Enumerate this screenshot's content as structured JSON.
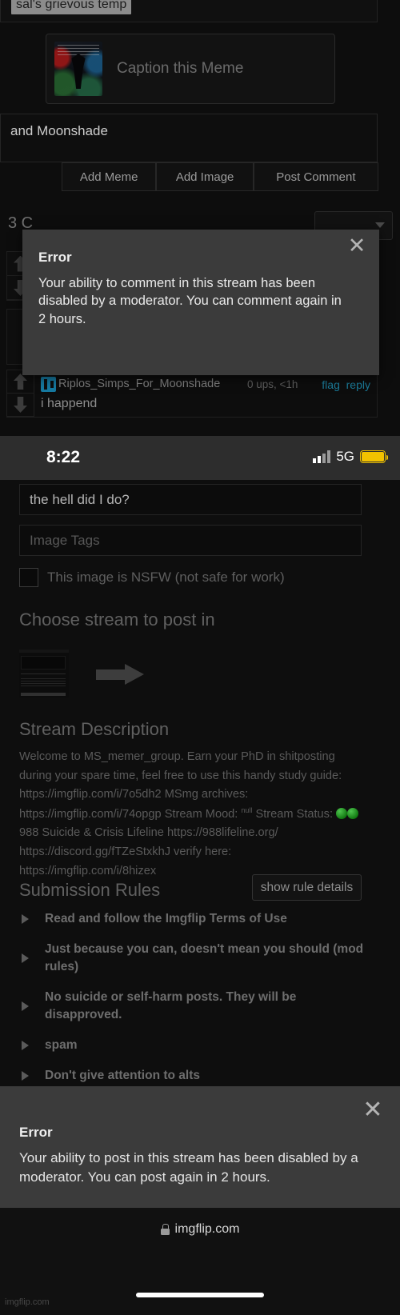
{
  "top_screen": {
    "clipped_text": "sal's grievous temp",
    "meme_attach_label": "Caption this Meme",
    "comment_input_value": "and Moonshade",
    "buttons": {
      "add_meme": "Add Meme",
      "add_image": "Add Image",
      "post_comment": "Post Comment"
    },
    "comments_header": "3 C",
    "comments": [
      {
        "username": "",
        "ups": "",
        "body": "",
        "reply": "reply"
      },
      {
        "username": "",
        "ups": "",
        "body": "",
        "reply": "reply"
      },
      {
        "username": "Riplos_Simps_For_Moonshade",
        "ups": "0 ups, <1h",
        "body": "i happend",
        "flag": "flag",
        "reply": "reply"
      }
    ],
    "error_modal": {
      "close": "✕",
      "title": "Error",
      "message": "Your ability to comment in this stream has been disabled by a moderator. You can comment again in 2 hours."
    }
  },
  "bottom_screen": {
    "statusbar": {
      "time": "8:22",
      "network": "5G",
      "battery_color": "#f2c200"
    },
    "title_field_value": "the hell did I do?",
    "tags_field_placeholder": "Image Tags",
    "nsfw_label": "This image is NSFW (not safe for work)",
    "choose_stream_heading": "Choose stream to post in",
    "stream_selected": "MS_memer_group",
    "stream_description_heading": "Stream Description",
    "stream_description_parts": {
      "p1": "Welcome to MS_memer_group. Earn your PhD in shitposting during your spare time, feel free to use this handy study guide: https://imgflip.com/i/7o5dh2 MSmg archives: https://imgflip.com/i/74opgp Stream Mood: ",
      "mood": "null",
      "p2": " Stream Status: ",
      "p3": " 988 Suicide & Crisis Lifeline https://988lifeline.org/ https://discord.gg/fTZeStxkhJ verify here: https://imgflip.com/i/8hizex"
    },
    "submission_rules_heading": "Submission Rules",
    "show_rule_details": "show rule details",
    "rules": [
      "Read and follow the Imgflip Terms of Use",
      "Just because you can, doesn't mean you should (mod rules)",
      "No suicide or self-harm posts. They will be disapproved.",
      "spam",
      "Don't give attention to alts"
    ],
    "error_banner": {
      "close": "✕",
      "title": "Error",
      "message": "Your ability to post in this stream has been disabled by a moderator. You can post again in 2 hours."
    },
    "browser": {
      "url": "imgflip.com",
      "watermark": "imgflip.com"
    }
  }
}
